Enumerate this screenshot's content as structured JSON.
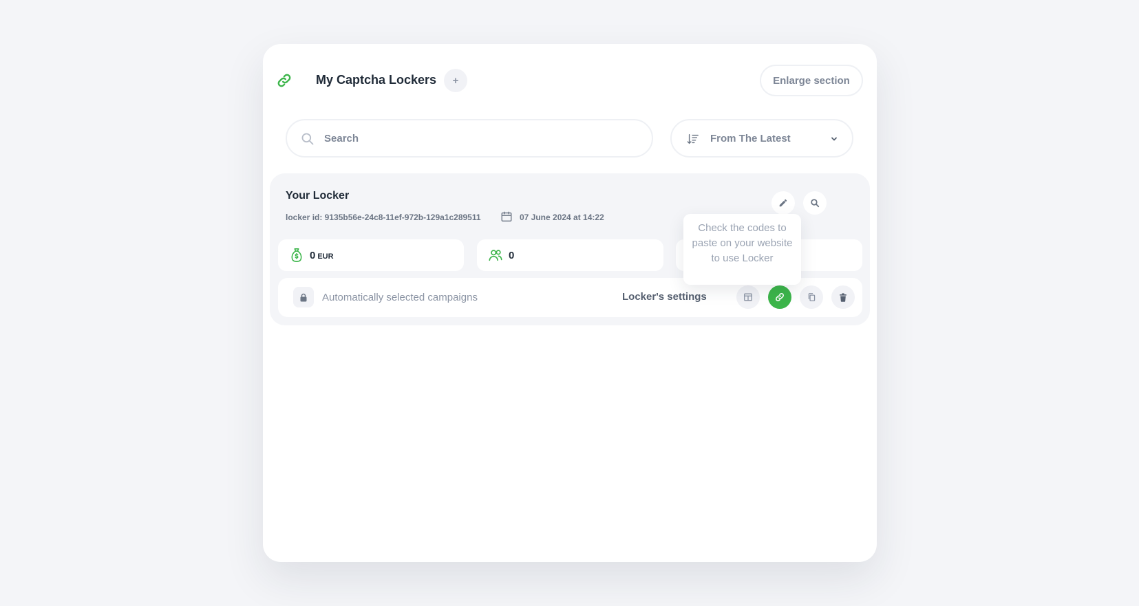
{
  "header": {
    "title": "My Captcha Lockers",
    "add_label": "+",
    "enlarge_label": "Enlarge section"
  },
  "search": {
    "placeholder": "Search",
    "value": ""
  },
  "sort": {
    "label": "From The Latest"
  },
  "locker": {
    "name": "Your Locker",
    "id_text": "locker id: 9135b56e-24c8-11ef-972b-129a1c289511",
    "date": "07 June 2024 at 14:22",
    "stats": {
      "earnings_value": "0",
      "earnings_currency": "EUR",
      "users_value": "0"
    },
    "campaigns_label": "Automatically selected campaigns",
    "settings_label": "Locker's settings"
  },
  "tooltip": {
    "text": "Check the codes to paste on your website to use Locker"
  },
  "colors": {
    "accent": "#3cb54a",
    "muted": "#8a93a3",
    "background": "#f4f5f8"
  },
  "icons": [
    "link-icon",
    "plus-icon",
    "search-icon",
    "sort-icon",
    "chevron-down-icon",
    "calendar-icon",
    "pencil-icon",
    "magnifier-icon",
    "money-bag-icon",
    "users-icon",
    "lock-icon",
    "layout-icon",
    "copy-icon",
    "trash-icon"
  ]
}
